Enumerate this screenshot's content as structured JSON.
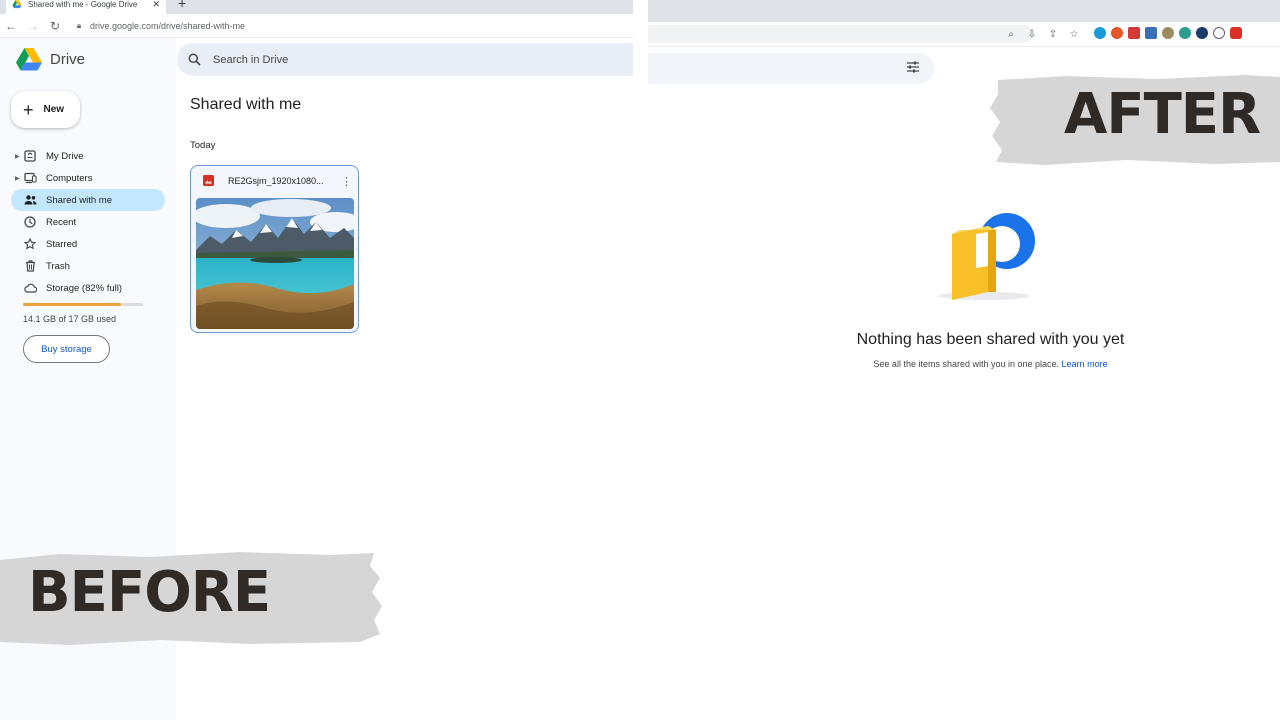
{
  "labels": {
    "before": "BEFORE",
    "after": "AFTER"
  },
  "before": {
    "browser": {
      "tab_title": "Shared with me - Google Drive",
      "url": "drive.google.com/drive/shared-with-me"
    },
    "sidebar": {
      "brand": "Drive",
      "new_button": "New",
      "items": [
        {
          "label": "My Drive",
          "icon": "my-drive-icon",
          "expandable": true,
          "active": false
        },
        {
          "label": "Computers",
          "icon": "computer-icon",
          "expandable": true,
          "active": false
        },
        {
          "label": "Shared with me",
          "icon": "people-icon",
          "expandable": false,
          "active": true
        },
        {
          "label": "Recent",
          "icon": "clock-icon",
          "expandable": false,
          "active": false
        },
        {
          "label": "Starred",
          "icon": "star-icon",
          "expandable": false,
          "active": false
        },
        {
          "label": "Trash",
          "icon": "trash-icon",
          "expandable": false,
          "active": false
        },
        {
          "label": "Storage (82% full)",
          "icon": "cloud-icon",
          "expandable": false,
          "active": false
        }
      ],
      "storage_percent": 82,
      "storage_used": "14.1 GB of 17 GB used",
      "buy_storage": "Buy storage"
    },
    "search_placeholder": "Search in Drive",
    "page_title": "Shared with me",
    "section": "Today",
    "file": {
      "name": "RE2Gsjm_1920x1080...",
      "type_icon": "image-file-icon"
    }
  },
  "after": {
    "empty_title": "Nothing has been shared with you yet",
    "empty_subtitle": "See all the items shared with you in one place.",
    "learn_more": "Learn more"
  },
  "colors": {
    "accent": "#0b57d0",
    "active_nav": "#c2e7ff",
    "storage_bar": "#e8a33d",
    "label_banner": "#d6d6d6",
    "label_text": "#2f2a26"
  }
}
